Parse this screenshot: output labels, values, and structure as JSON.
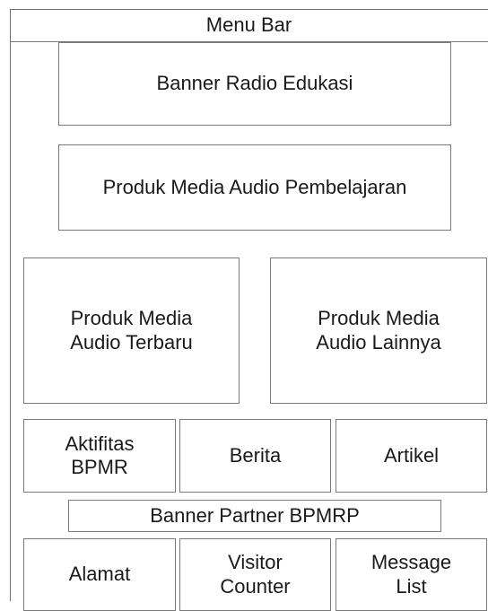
{
  "menu_bar": {
    "label": "Menu Bar"
  },
  "banner_radio": {
    "label": "Banner Radio Edukasi"
  },
  "produk_pembelajaran": {
    "label": "Produk Media Audio Pembelajaran"
  },
  "produk_terbaru": {
    "label": "Produk Media\nAudio Terbaru"
  },
  "produk_lainnya": {
    "label": "Produk Media\nAudio Lainnya"
  },
  "aktifitas": {
    "label": "Aktifitas\nBPMR"
  },
  "berita": {
    "label": "Berita"
  },
  "artikel": {
    "label": "Artikel"
  },
  "banner_partner": {
    "label": "Banner Partner BPMRP"
  },
  "alamat": {
    "label": "Alamat"
  },
  "visitor_counter": {
    "label": "Visitor\nCounter"
  },
  "message_list": {
    "label": "Message\nList"
  }
}
